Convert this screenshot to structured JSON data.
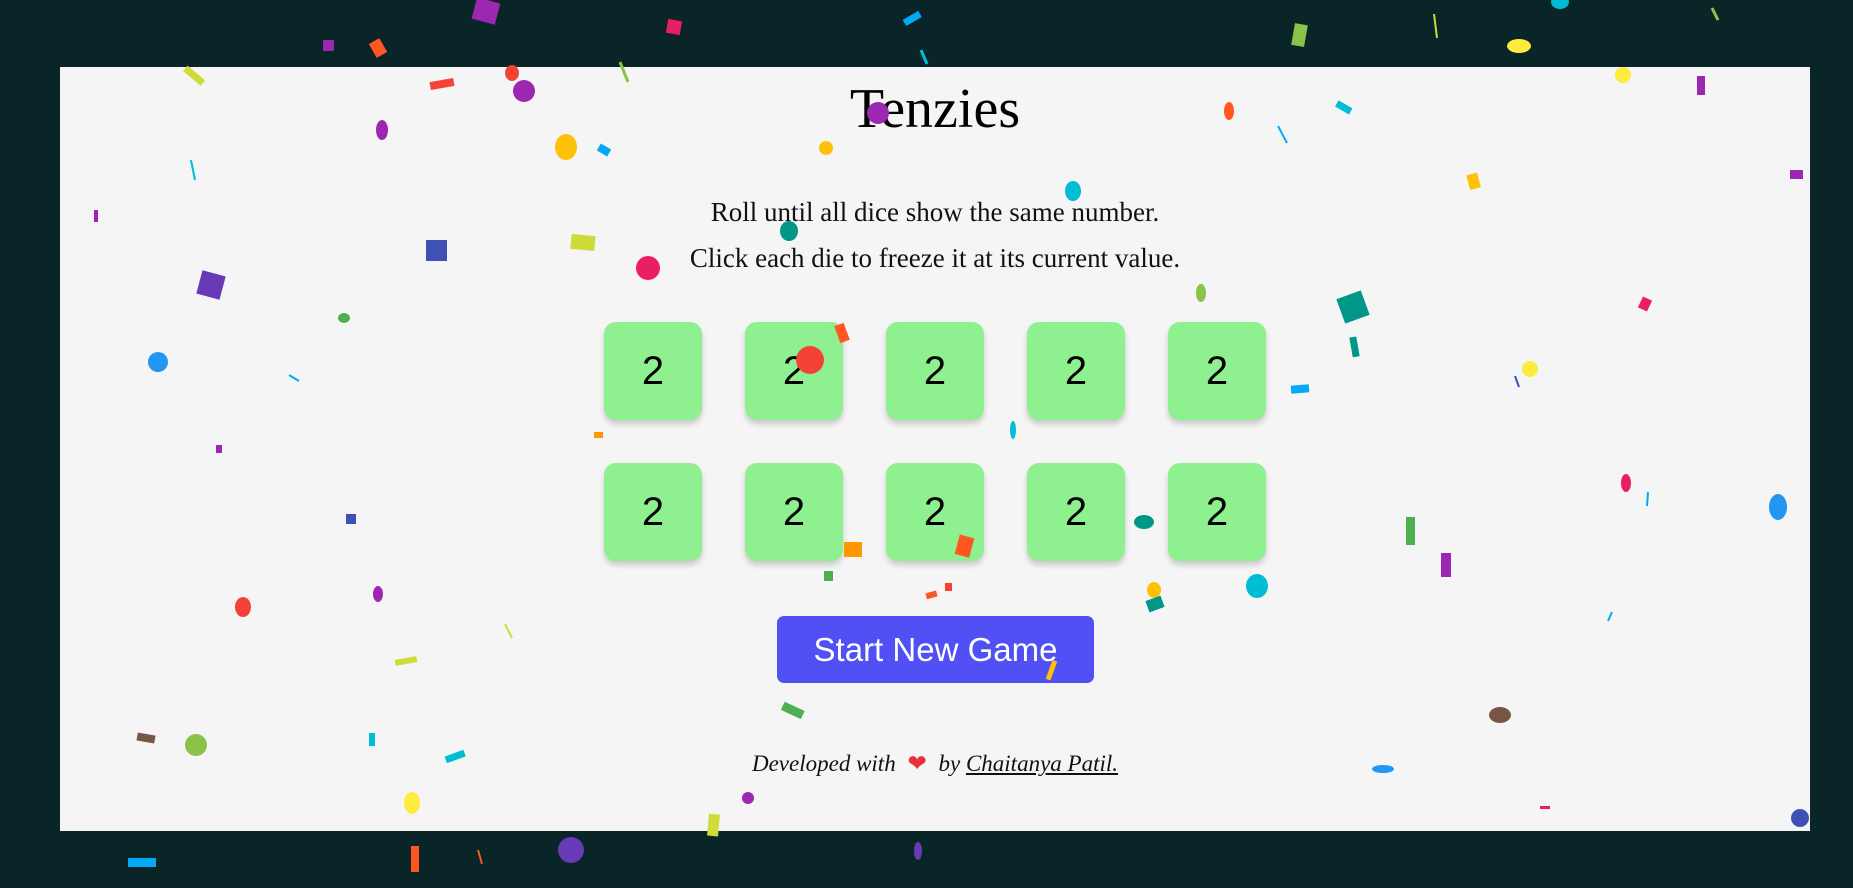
{
  "game": {
    "title": "Tenzies",
    "instruction_line1": "Roll until all dice show the same number.",
    "instruction_line2": "Click each die to freeze it at its current value.",
    "dice": [
      "2",
      "2",
      "2",
      "2",
      "2",
      "2",
      "2",
      "2",
      "2",
      "2"
    ],
    "button_label": "Start New Game"
  },
  "footer": {
    "prefix": "Developed with",
    "heart": "❤",
    "by": "by",
    "author": "Chaitanya Patil."
  },
  "colors": {
    "page_bg": "#0a2527",
    "board_bg": "#f5f5f5",
    "die_bg": "#8ef08e",
    "button_bg": "#5050f5"
  }
}
